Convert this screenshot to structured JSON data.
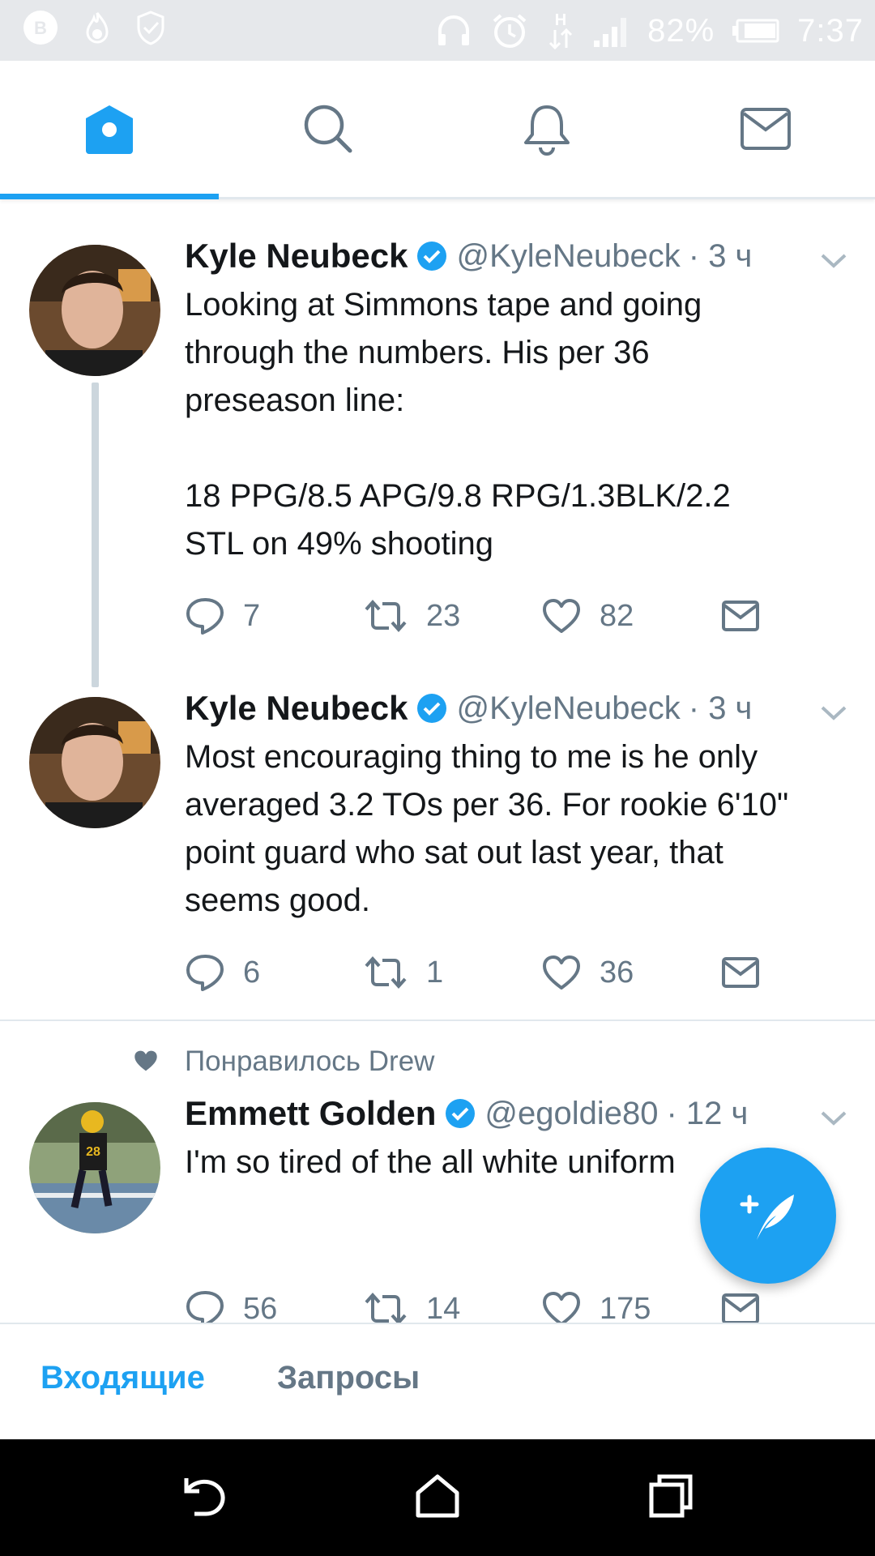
{
  "status_bar": {
    "battery_percent": "82%",
    "time": "7:37",
    "left_icons": [
      "vk-icon",
      "fire-icon",
      "shield-check-icon"
    ],
    "right_icons": [
      "headphones-icon",
      "alarm-icon",
      "data-h-icon",
      "signal-icon",
      "battery-icon"
    ]
  },
  "tabs": [
    {
      "name": "home",
      "icon": "home-icon",
      "active": true
    },
    {
      "name": "search",
      "icon": "search-icon",
      "active": false
    },
    {
      "name": "notifications",
      "icon": "bell-icon",
      "active": false
    },
    {
      "name": "messages",
      "icon": "mail-icon",
      "active": false
    }
  ],
  "accent_color": "#1da1f2",
  "tweets": [
    {
      "name": "Kyle Neubeck",
      "handle": "@KyleNeubeck",
      "time": "· 3 ч",
      "text": "Looking at Simmons tape and going\nthrough the numbers. His per 36\npreseason line:\n\n18 PPG/8.5 APG/9.8 RPG/1.3BLK/2.2\nSTL on 49% shooting",
      "replies": "7",
      "retweets": "23",
      "likes": "82"
    },
    {
      "name": "Kyle Neubeck",
      "handle": "@KyleNeubeck",
      "time": "· 3 ч",
      "text": "Most encouraging thing to me is he only\naveraged 3.2 TOs per 36. For rookie 6'10\"\npoint guard who sat out last year, that\nseems good.",
      "replies": "6",
      "retweets": "1",
      "likes": "36"
    },
    {
      "liked_by": "Понравилось Drew",
      "name": "Emmett Golden",
      "handle": "@egoldie80",
      "time": "· 12 ч",
      "text": "I'm so tired of the all white uniform",
      "replies": "56",
      "retweets": "14",
      "likes": "175"
    }
  ],
  "dm_tabs": {
    "inbox": "Входящие",
    "requests": "Запросы"
  },
  "nav": [
    "back-icon",
    "home-outline-icon",
    "recents-icon"
  ]
}
